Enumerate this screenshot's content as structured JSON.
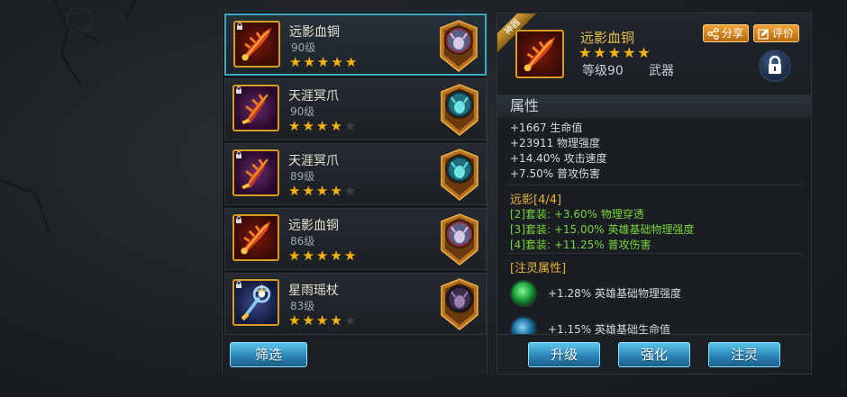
{
  "items": [
    {
      "name": "远影血铜",
      "level": "90级",
      "stars": 5,
      "max_stars": 5,
      "icon": "red-blade-icon",
      "hero": "horned-hero-portrait"
    },
    {
      "name": "天涯冥爪",
      "level": "90级",
      "stars": 4,
      "max_stars": 5,
      "icon": "purple-claw-icon",
      "hero": "cyan-hero-portrait"
    },
    {
      "name": "天涯冥爪",
      "level": "89级",
      "stars": 4,
      "max_stars": 5,
      "icon": "purple-claw-icon",
      "hero": "cyan-hero-portrait"
    },
    {
      "name": "远影血铜",
      "level": "86级",
      "stars": 5,
      "max_stars": 5,
      "icon": "red-blade-icon",
      "hero": "horned-hero-portrait"
    },
    {
      "name": "星雨瑶杖",
      "level": "83级",
      "stars": 4,
      "max_stars": 5,
      "icon": "star-staff-icon",
      "hero": "hooded-hero-portrait"
    }
  ],
  "filter_label": "筛选",
  "detail": {
    "badge": "神器",
    "name": "远影血铜",
    "stars": 5,
    "level": "等级90",
    "type": "武器",
    "share_label": "分享",
    "review_label": "评价"
  },
  "attributes": {
    "title": "属性",
    "lines": [
      "+1667 生命值",
      "+23911 物理强度",
      "+14.40% 攻击速度",
      "+7.50% 普攻伤害"
    ]
  },
  "set": {
    "title": "远影[4/4]",
    "lines": [
      "[2]套装: +3.60% 物理穿透",
      "[3]套装: +15.00% 英雄基础物理强度",
      "[4]套装: +11.25% 普攻伤害"
    ]
  },
  "spirit": {
    "title": "[注灵属性]",
    "lines": [
      "+1.28% 英雄基础物理强度",
      "+1.15% 英雄基础生命值"
    ]
  },
  "actions": {
    "upgrade": "升级",
    "enhance": "强化",
    "infuse": "注灵"
  },
  "colors": {
    "accent_gold": "#e8b23a",
    "set_green": "#78d23b",
    "button_blue": "#2b86b7",
    "selection": "#3aa7bf"
  }
}
